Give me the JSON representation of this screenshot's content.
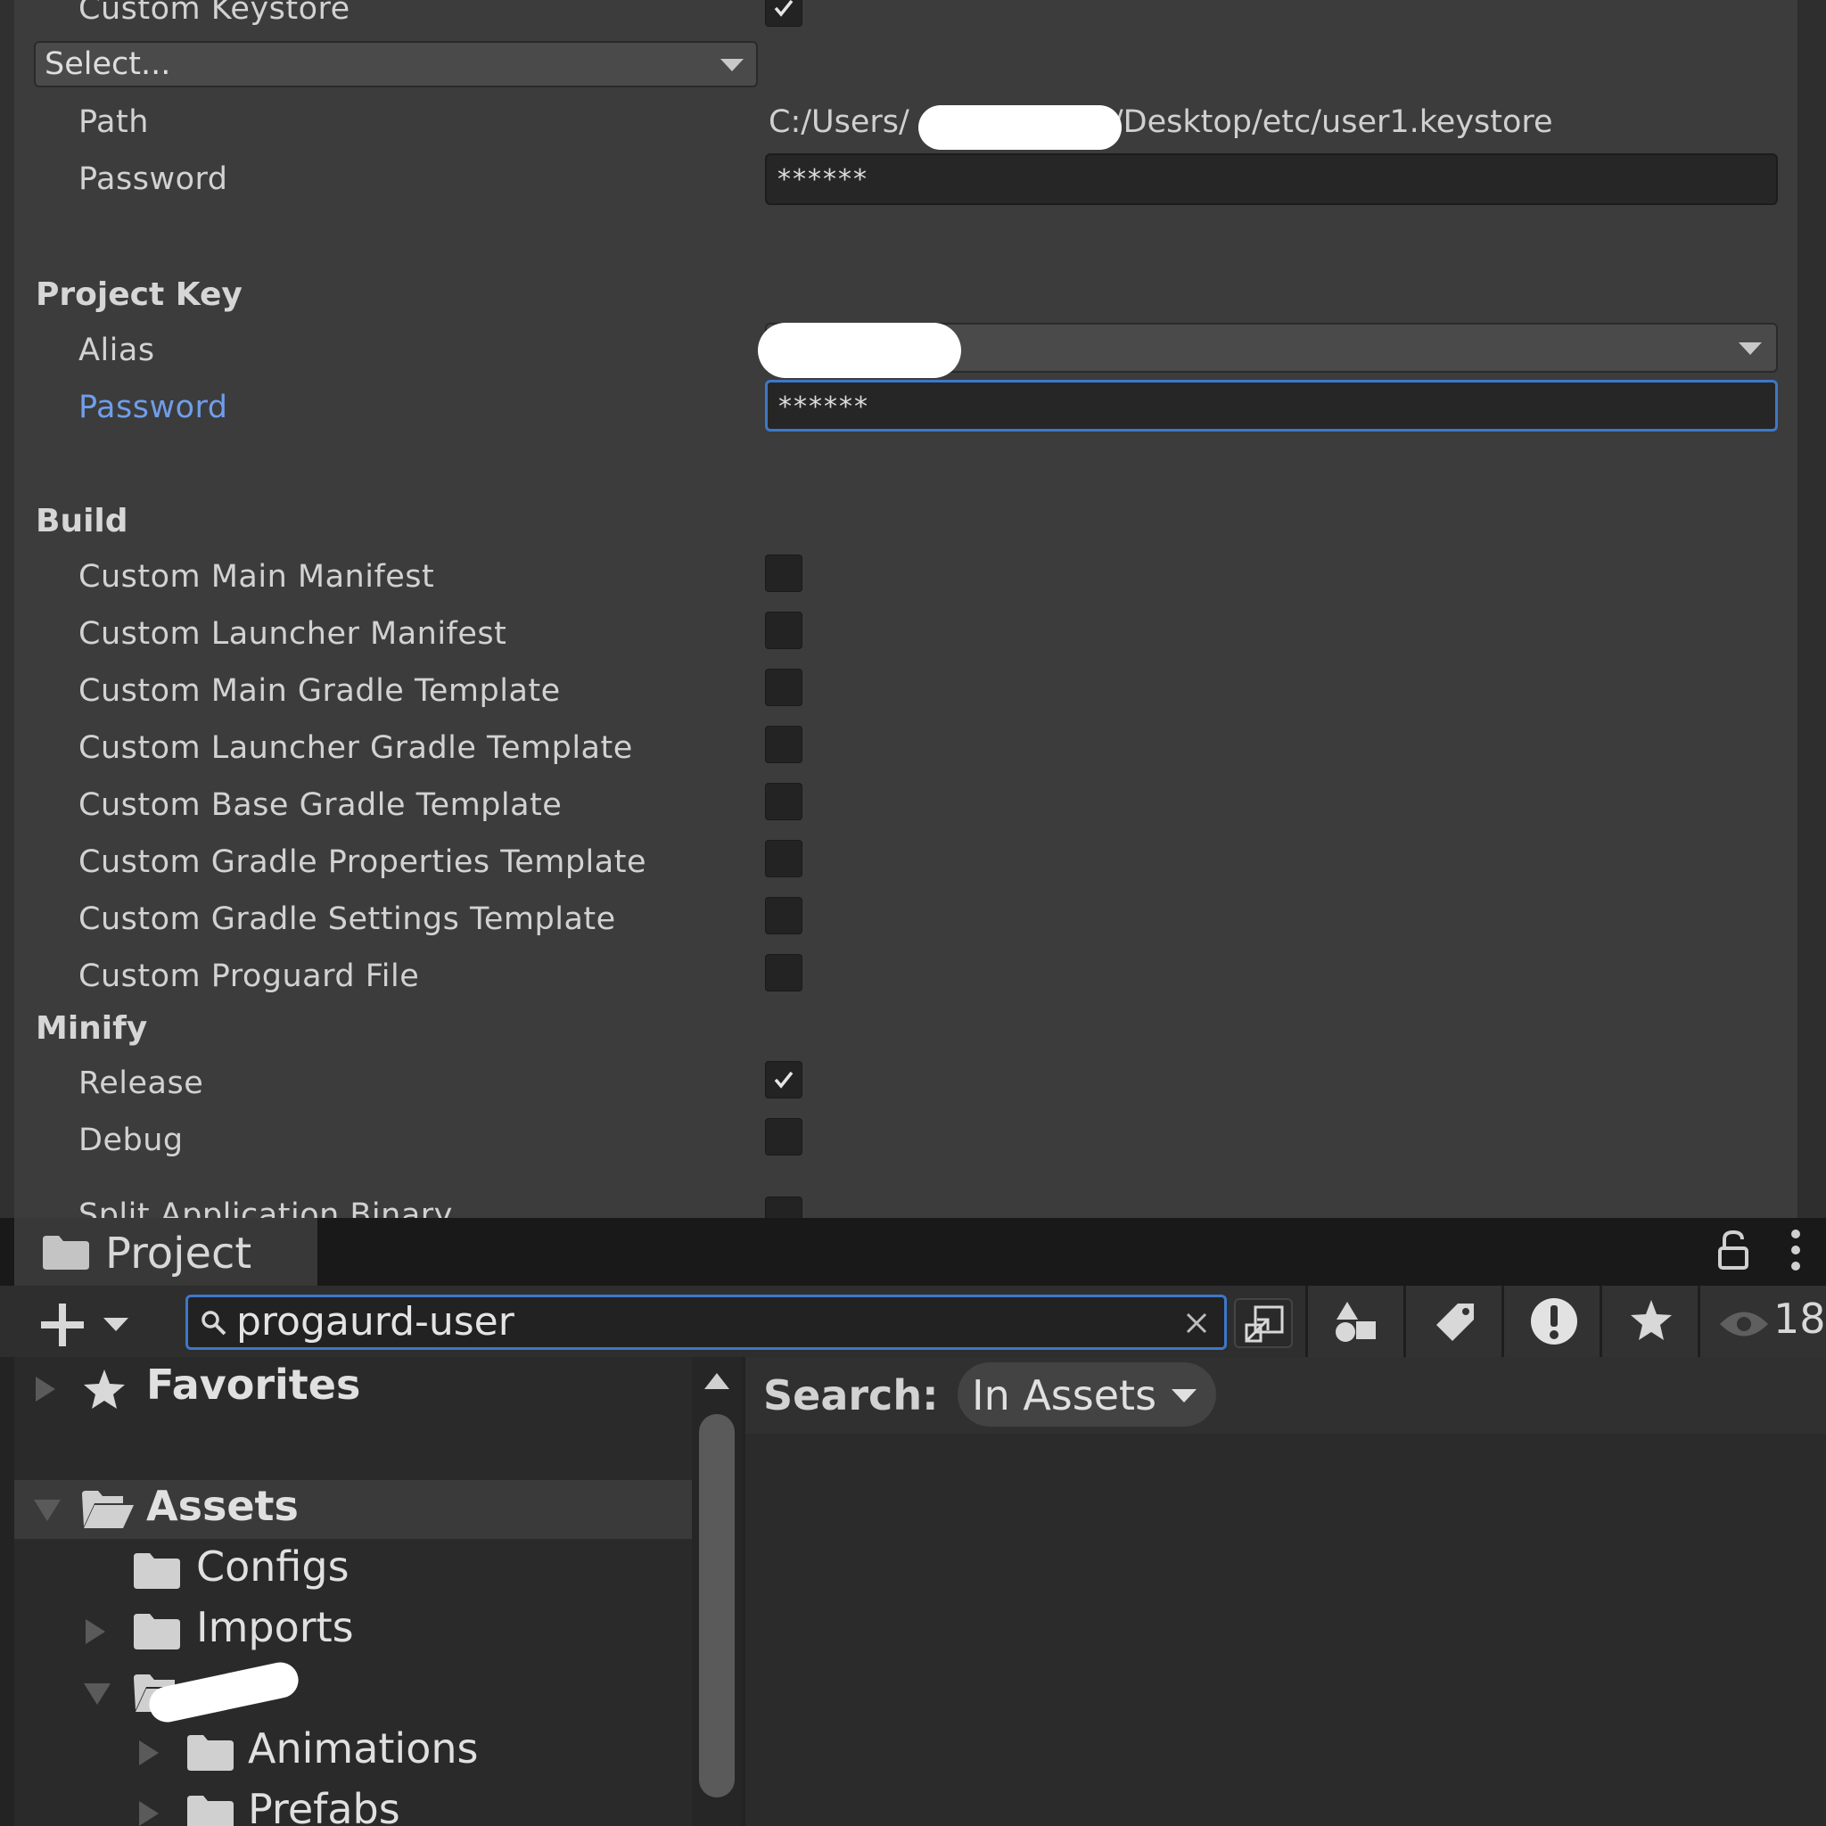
{
  "inspector": {
    "custom_keystore_label": "Custom Keystore",
    "keystore_select": "Select...",
    "path_label": "Path",
    "path_prefix": "C:/Users/",
    "path_suffix": "/Desktop/etc/user1.keystore",
    "keystore_password_label": "Password",
    "keystore_password_value": "******",
    "project_key_header": "Project Key",
    "alias_label": "Alias",
    "key_password_label": "Password",
    "key_password_value": "******",
    "build_header": "Build",
    "build_options": [
      {
        "label": "Custom Main Manifest",
        "checked": false
      },
      {
        "label": "Custom Launcher Manifest",
        "checked": false
      },
      {
        "label": "Custom Main Gradle Template",
        "checked": false
      },
      {
        "label": "Custom Launcher Gradle Template",
        "checked": false
      },
      {
        "label": "Custom Base Gradle Template",
        "checked": false
      },
      {
        "label": "Custom Gradle Properties Template",
        "checked": false
      },
      {
        "label": "Custom Gradle Settings Template",
        "checked": false
      },
      {
        "label": "Custom Proguard File",
        "checked": false
      }
    ],
    "minify_header": "Minify",
    "minify_release_label": "Release",
    "minify_debug_label": "Debug",
    "split_binary_label": "Split Application Binary",
    "accent_color": "#4d8ef0"
  },
  "project": {
    "tab_title": "Project",
    "search_value": "progaurd-user",
    "count": "18",
    "search_label": "Search:",
    "search_scope": "In Assets",
    "tree": {
      "favorites": "Favorites",
      "assets": "Assets",
      "configs": "Configs",
      "imports": "Imports",
      "animations": "Animations",
      "prefabs": "Prefabs"
    },
    "search_border_color": "#3d78c8"
  }
}
